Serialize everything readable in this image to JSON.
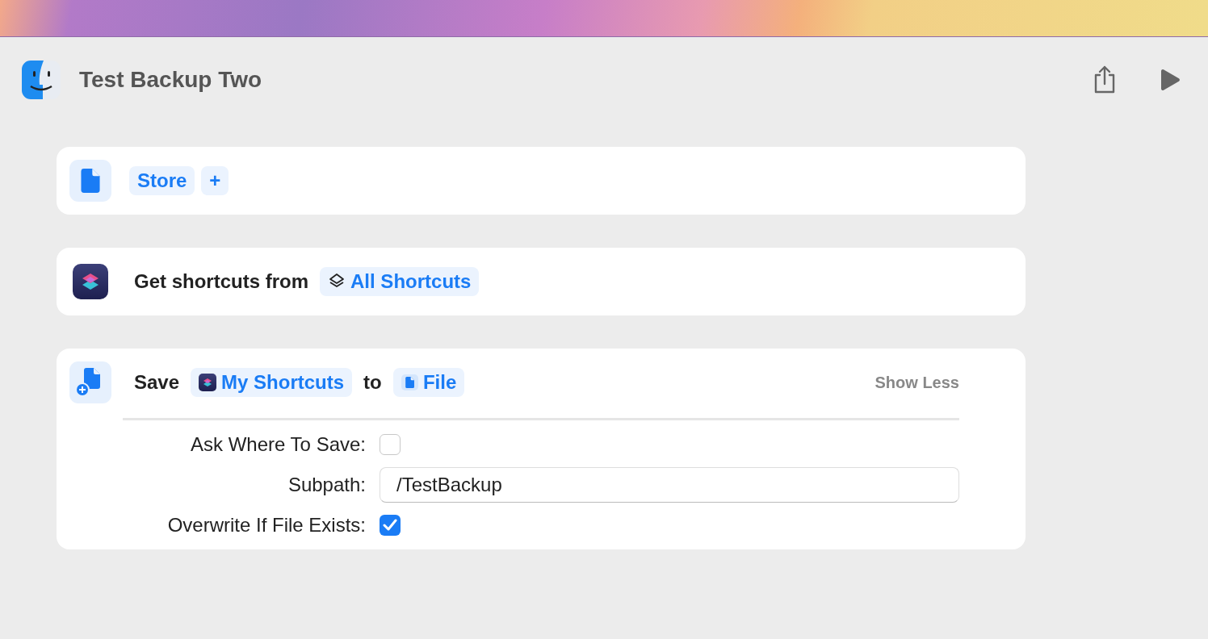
{
  "window": {
    "title": "Test Backup Two"
  },
  "actions": [
    {
      "kind": "document",
      "parts": [
        {
          "kind": "token",
          "label": "Store"
        },
        {
          "kind": "add",
          "label": "+"
        }
      ]
    },
    {
      "kind": "shortcuts",
      "parts": [
        {
          "kind": "text",
          "label": "Get shortcuts from"
        },
        {
          "kind": "layers-token",
          "label": "All Shortcuts"
        }
      ]
    },
    {
      "kind": "save-file",
      "parts": [
        {
          "kind": "text",
          "label": "Save"
        },
        {
          "kind": "app-token",
          "label": "My Shortcuts"
        },
        {
          "kind": "text",
          "label": "to"
        },
        {
          "kind": "file-token",
          "label": "File"
        }
      ],
      "toggle": "Show Less",
      "options": [
        {
          "kind": "checkbox",
          "label": "Ask Where To Save:",
          "checked": false
        },
        {
          "kind": "field",
          "label": "Subpath:",
          "value": "/TestBackup"
        },
        {
          "kind": "checkbox",
          "label": "Overwrite If File Exists:",
          "checked": true
        }
      ]
    }
  ]
}
